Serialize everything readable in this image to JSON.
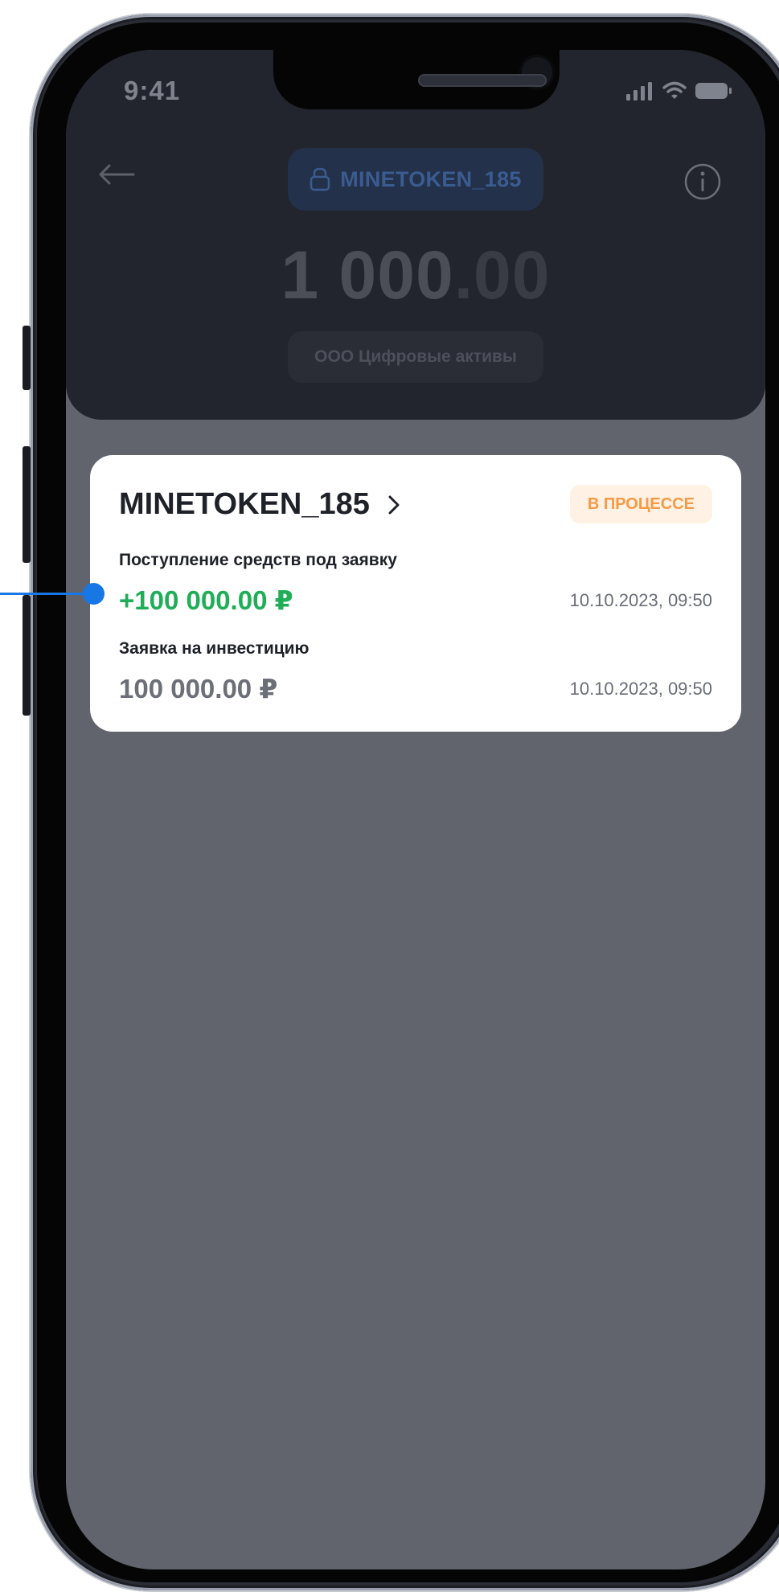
{
  "status_bar": {
    "time": "9:41"
  },
  "header": {
    "token_name": "MINETOKEN_185",
    "balance_integer": "1 000",
    "balance_decimal": ".00",
    "company": "ООО Цифровые активы",
    "icons": {
      "back": "arrow-left-icon",
      "info": "info-icon",
      "lock": "lock-icon"
    }
  },
  "card": {
    "title": "MINETOKEN_185",
    "status": "В ПРОЦЕССЕ",
    "transactions": [
      {
        "label": "Поступление средств под заявку",
        "amount": "+100 000.00 ₽",
        "date": "10.10.2023, 09:50"
      },
      {
        "label": "Заявка на инвестицию",
        "amount": "100 000.00 ₽",
        "date": "10.10.2023, 09:50"
      }
    ]
  },
  "colors": {
    "accent_blue": "#1677e5",
    "positive_green": "#1fae57",
    "status_orange": "#f59a45",
    "overlay_gray": "#62646d",
    "header_dark": "#22252d"
  }
}
